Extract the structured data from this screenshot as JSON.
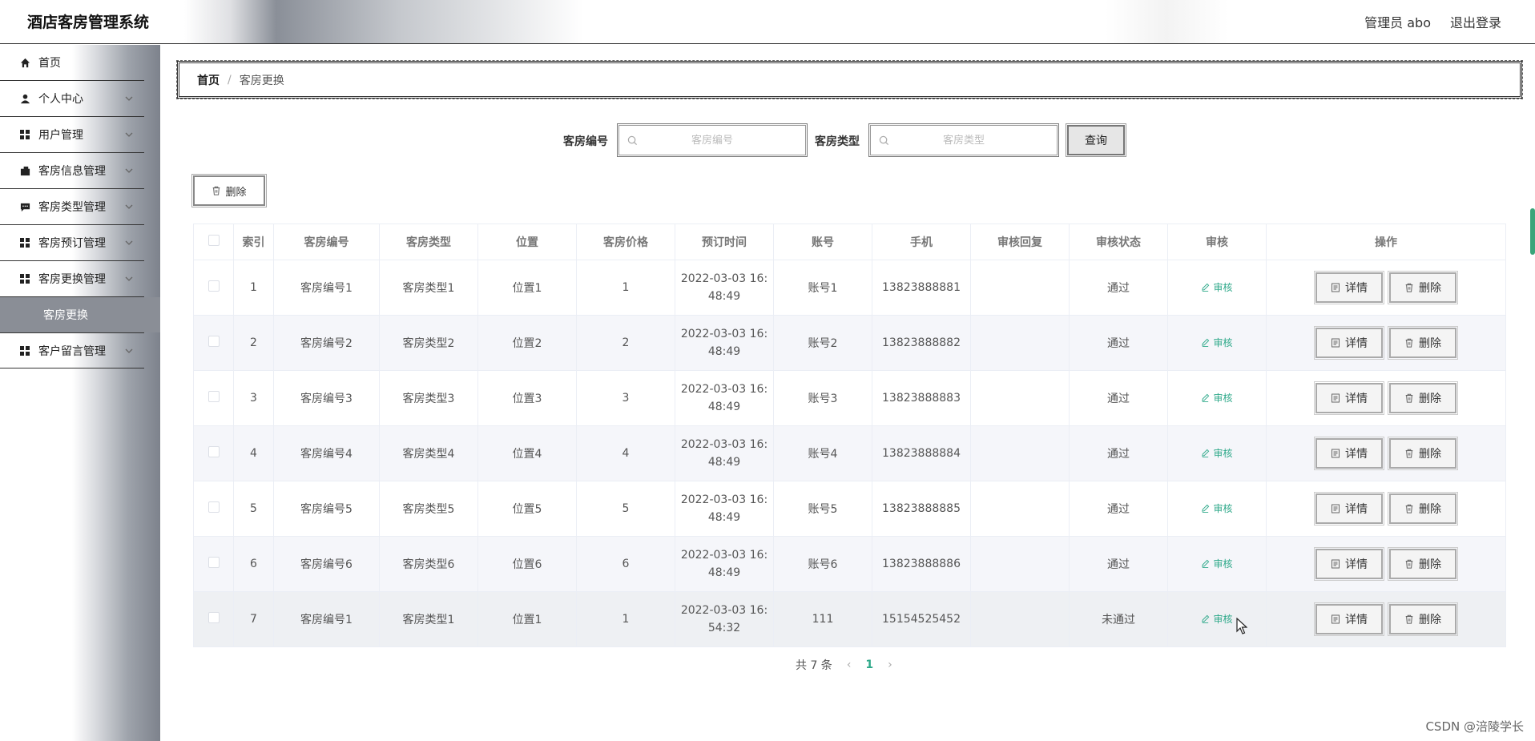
{
  "header": {
    "title": "酒店客房管理系统",
    "user": "管理员 abo",
    "logout": "退出登录"
  },
  "sidebar": {
    "items": [
      {
        "label": "首页",
        "icon": "home-icon"
      },
      {
        "label": "个人中心",
        "icon": "user-icon"
      },
      {
        "label": "用户管理",
        "icon": "grid-icon"
      },
      {
        "label": "客房信息管理",
        "icon": "wallet-icon"
      },
      {
        "label": "客房类型管理",
        "icon": "chat-icon"
      },
      {
        "label": "客房预订管理",
        "icon": "grid-icon"
      },
      {
        "label": "客房更换管理",
        "icon": "grid-icon"
      },
      {
        "label": "客户留言管理",
        "icon": "grid-icon"
      }
    ],
    "sub_active": "客房更换"
  },
  "breadcrumb": {
    "home": "首页",
    "sep": "/",
    "current": "客房更换"
  },
  "search": {
    "room_no_label": "客房编号",
    "room_no_placeholder": "客房编号",
    "room_type_label": "客房类型",
    "room_type_placeholder": "客房类型",
    "query_label": "查询"
  },
  "batch_delete_label": "删除",
  "table": {
    "headers": [
      "索引",
      "客房编号",
      "客房类型",
      "位置",
      "客房价格",
      "预订时间",
      "账号",
      "手机",
      "审核回复",
      "审核状态",
      "审核",
      "操作"
    ],
    "rows": [
      {
        "idx": "1",
        "room_no": "客房编号1",
        "room_type": "客房类型1",
        "location": "位置1",
        "price": "1",
        "time1": "2022-03-03 16:",
        "time2": "48:49",
        "account": "账号1",
        "phone": "13823888881",
        "reply": "",
        "status": "通过",
        "audit": "审核",
        "detail": "详情",
        "delete": "删除"
      },
      {
        "idx": "2",
        "room_no": "客房编号2",
        "room_type": "客房类型2",
        "location": "位置2",
        "price": "2",
        "time1": "2022-03-03 16:",
        "time2": "48:49",
        "account": "账号2",
        "phone": "13823888882",
        "reply": "",
        "status": "通过",
        "audit": "审核",
        "detail": "详情",
        "delete": "删除"
      },
      {
        "idx": "3",
        "room_no": "客房编号3",
        "room_type": "客房类型3",
        "location": "位置3",
        "price": "3",
        "time1": "2022-03-03 16:",
        "time2": "48:49",
        "account": "账号3",
        "phone": "13823888883",
        "reply": "",
        "status": "通过",
        "audit": "审核",
        "detail": "详情",
        "delete": "删除"
      },
      {
        "idx": "4",
        "room_no": "客房编号4",
        "room_type": "客房类型4",
        "location": "位置4",
        "price": "4",
        "time1": "2022-03-03 16:",
        "time2": "48:49",
        "account": "账号4",
        "phone": "13823888884",
        "reply": "",
        "status": "通过",
        "audit": "审核",
        "detail": "详情",
        "delete": "删除"
      },
      {
        "idx": "5",
        "room_no": "客房编号5",
        "room_type": "客房类型5",
        "location": "位置5",
        "price": "5",
        "time1": "2022-03-03 16:",
        "time2": "48:49",
        "account": "账号5",
        "phone": "13823888885",
        "reply": "",
        "status": "通过",
        "audit": "审核",
        "detail": "详情",
        "delete": "删除"
      },
      {
        "idx": "6",
        "room_no": "客房编号6",
        "room_type": "客房类型6",
        "location": "位置6",
        "price": "6",
        "time1": "2022-03-03 16:",
        "time2": "48:49",
        "account": "账号6",
        "phone": "13823888886",
        "reply": "",
        "status": "通过",
        "audit": "审核",
        "detail": "详情",
        "delete": "删除"
      },
      {
        "idx": "7",
        "room_no": "客房编号1",
        "room_type": "客房类型1",
        "location": "位置1",
        "price": "1",
        "time1": "2022-03-03 16:",
        "time2": "54:32",
        "account": "111",
        "phone": "15154525452",
        "reply": "",
        "status": "未通过",
        "audit": "审核",
        "detail": "详情",
        "delete": "删除"
      }
    ]
  },
  "pagination": {
    "total": "共 7 条",
    "prev": "‹",
    "page": "1",
    "next": "›"
  },
  "watermark": "CSDN @涪陵学长",
  "colors": {
    "accent": "#2fa98a",
    "border": "#333333",
    "sidebar_active": "#8a8e96"
  }
}
